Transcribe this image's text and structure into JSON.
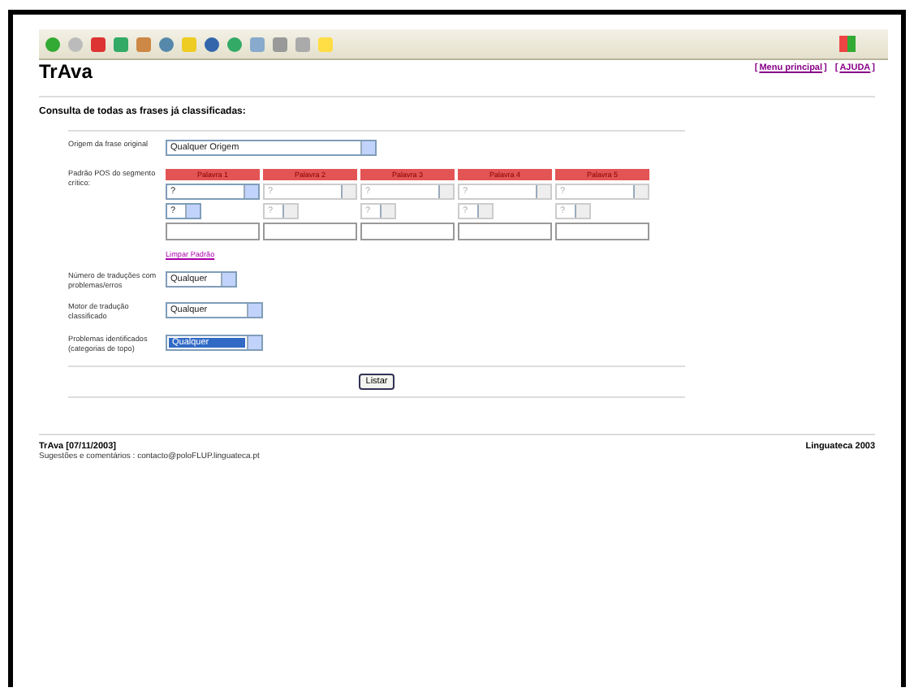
{
  "page": {
    "title": "TrAva",
    "links": [
      {
        "open": "[",
        "text": "Menu principal",
        "close": "]"
      },
      {
        "open": "[",
        "text": "AJUDA",
        "close": "]"
      }
    ],
    "heading": "Consulta de todas as frases já classificadas:"
  },
  "form": {
    "origin": {
      "label": "Origem da frase original",
      "value": "Qualquer Origem"
    },
    "pattern": {
      "label": "Padrão POS do segmento crítico:",
      "columns": [
        {
          "header": "Palavra 1",
          "tag": "?",
          "sub": "?",
          "disabled": false
        },
        {
          "header": "Palavra 2",
          "tag": "?",
          "sub": "?",
          "disabled": true
        },
        {
          "header": "Palavra 3",
          "tag": "?",
          "sub": "?",
          "disabled": true
        },
        {
          "header": "Palavra 4",
          "tag": "?",
          "sub": "?",
          "disabled": true
        },
        {
          "header": "Palavra 5",
          "tag": "?",
          "sub": "?",
          "disabled": true
        }
      ],
      "clear_link": "Limpar Padrão"
    },
    "selects": [
      {
        "label": "Número de traduções com problemas/erros",
        "value": "Qualquer",
        "focused": false
      },
      {
        "label": "Motor de tradução classificado",
        "value": "Qualquer",
        "focused": false
      },
      {
        "label": "Problemas identificados (categorias de topo)",
        "value": "Qualquer",
        "focused": true
      }
    ],
    "submit": "Listar"
  },
  "footer": {
    "app": "TrAva [07/11/2003]",
    "org": "Linguateca 2003",
    "contact": "Sugestões e comentários : contacto@poloFLUP.linguateca.pt"
  }
}
